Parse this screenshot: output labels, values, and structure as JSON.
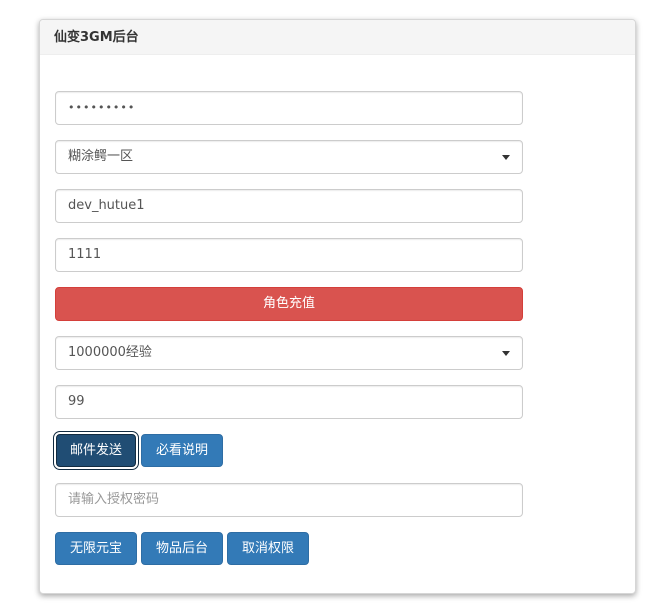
{
  "panel": {
    "title": "仙变3GM后台"
  },
  "form": {
    "password_masked": "•••••••••",
    "server_select": "糊涂鳄一区",
    "account_value": "dev_hutue1",
    "amount_value": "1111",
    "recharge_button": "角色充值",
    "item_select": "1000000经验",
    "quantity_value": "99",
    "mail_send_button": "邮件发送",
    "read_instructions_button": "必看说明",
    "auth_placeholder": "请输入授权密码",
    "unlimited_yuanbao_button": "无限元宝",
    "item_backend_button": "物品后台",
    "cancel_permission_button": "取消权限"
  },
  "colors": {
    "danger": "#d9534f",
    "primary": "#337ab7"
  }
}
